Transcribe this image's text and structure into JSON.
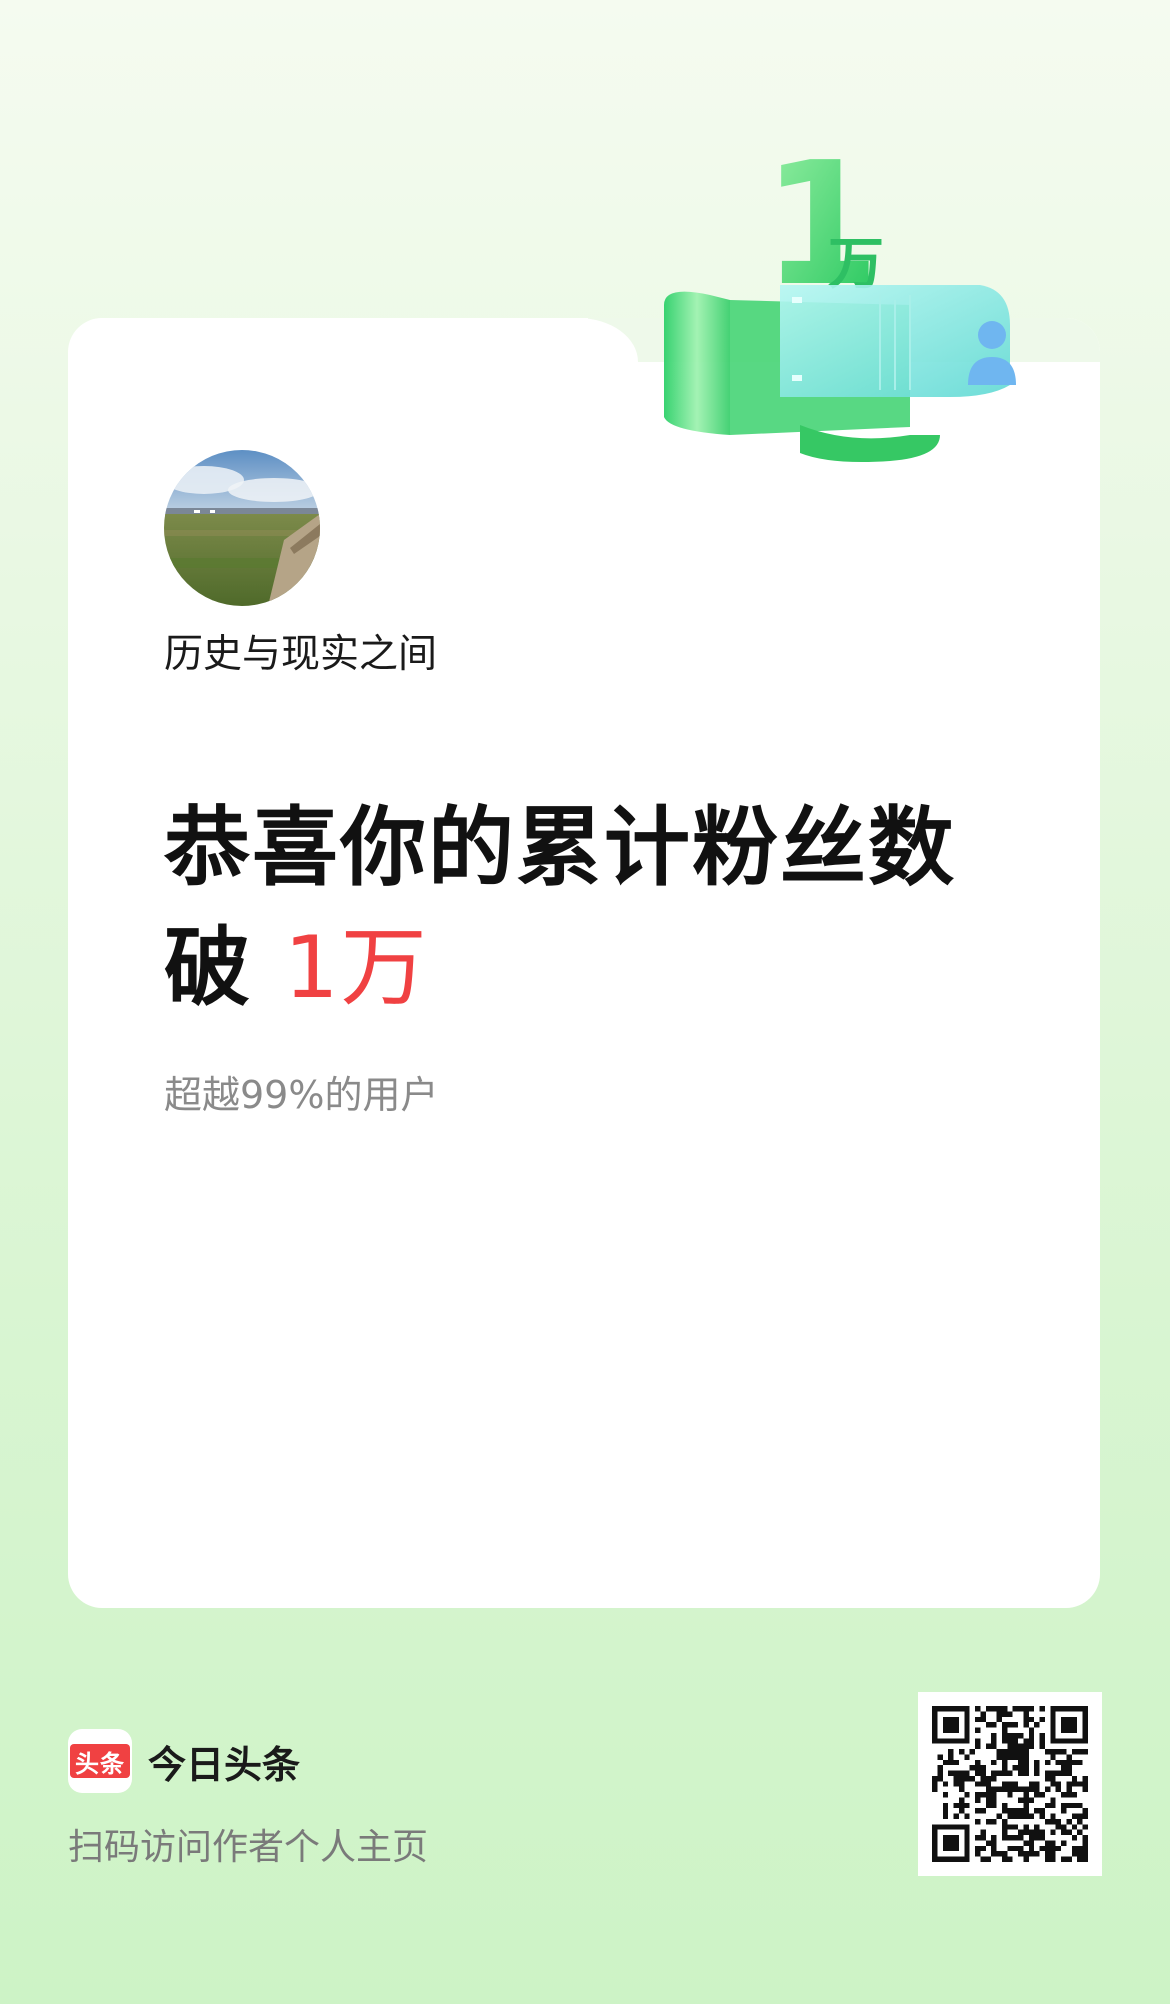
{
  "card": {
    "username": "历史与现实之间",
    "headline_line1": "恭喜你的累计粉丝数",
    "headline_prefix": "破 ",
    "headline_value": "1万",
    "subline": "超越99%的用户"
  },
  "badge": {
    "number": "1",
    "unit": "万"
  },
  "footer": {
    "brand_logo_text": "头条",
    "brand_name": "今日头条",
    "scan_hint": "扫码访问作者个人主页"
  },
  "colors": {
    "accent_red": "#f04142",
    "badge_green": "#3ccf6e",
    "badge_cyan": "#7fe6e0"
  },
  "icons": {
    "avatar": "landscape-photo",
    "badge_user": "user-icon",
    "qr": "qr-code"
  }
}
